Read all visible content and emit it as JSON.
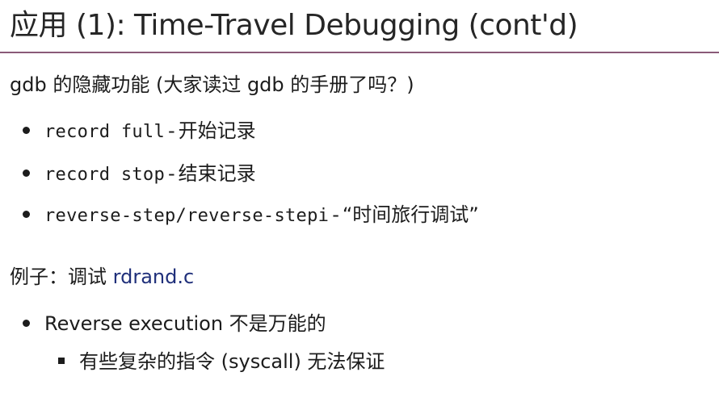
{
  "slide": {
    "title": "应用 (1): Time-Travel Debugging (cont'd)",
    "intro": "gdb 的隐藏功能 (大家读过 gdb 的手册了吗？)",
    "commands": [
      {
        "code": "record full",
        "separator": "-",
        "desc": "开始记录"
      },
      {
        "code": "record stop",
        "separator": "-",
        "desc": "结束记录"
      },
      {
        "code": "reverse-step/reverse-stepi",
        "separator": "-",
        "desc": "“时间旅行调试”"
      }
    ],
    "example": {
      "prefix": "例子：调试 ",
      "link": "rdrand.c"
    },
    "notes": [
      {
        "text": "Reverse execution 不是万能的",
        "sub": "有些复杂的指令 (syscall) 无法保证"
      }
    ]
  },
  "colors": {
    "title_rule": "#8a5a78",
    "link": "#1f2f7a",
    "text": "#1c1c1c"
  }
}
